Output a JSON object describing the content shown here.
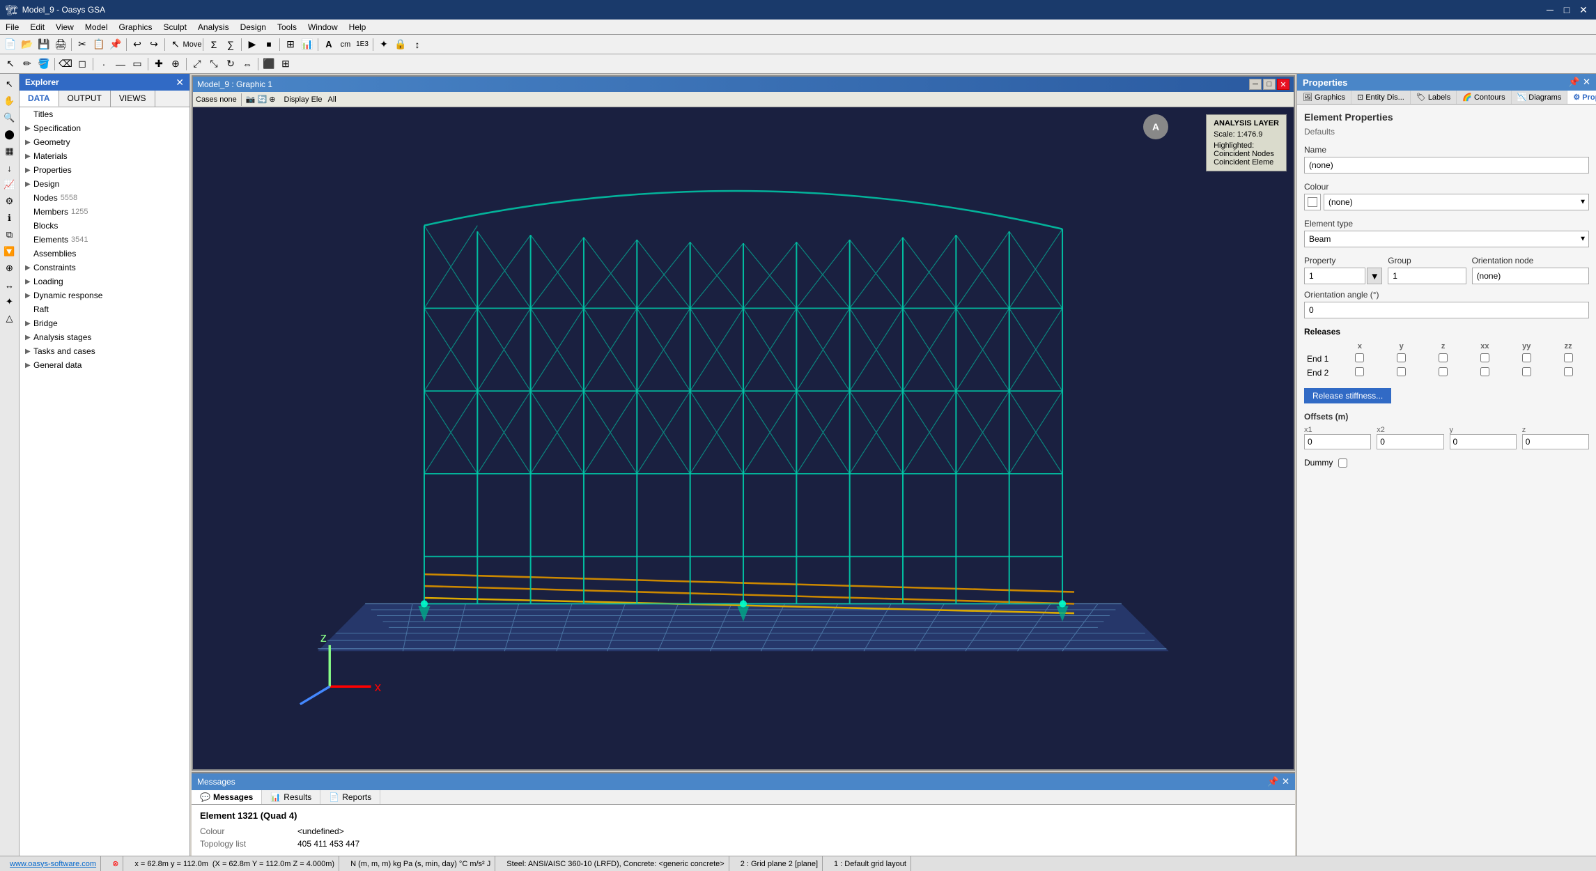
{
  "app": {
    "title": "Model_9 - Oasys GSA",
    "icon": "GSA"
  },
  "titlebar": {
    "minimize": "─",
    "maximize": "□",
    "close": "✕"
  },
  "menubar": {
    "items": [
      "File",
      "Edit",
      "View",
      "Model",
      "Graphics",
      "Sculpt",
      "Analysis",
      "Design",
      "Tools",
      "Window",
      "Help"
    ]
  },
  "explorer": {
    "title": "Explorer",
    "tabs": [
      "DATA",
      "OUTPUT",
      "VIEWS"
    ],
    "active_tab": "DATA",
    "tree": [
      {
        "label": "Titles",
        "type": "leaf",
        "indent": 0
      },
      {
        "label": "Specification",
        "type": "expandable",
        "indent": 0
      },
      {
        "label": "Geometry",
        "type": "expandable",
        "indent": 0
      },
      {
        "label": "Materials",
        "type": "expandable",
        "indent": 0
      },
      {
        "label": "Properties",
        "type": "expandable",
        "indent": 0
      },
      {
        "label": "Design",
        "type": "expandable",
        "indent": 0
      },
      {
        "label": "Nodes",
        "type": "leaf-count",
        "indent": 0,
        "count": "5558"
      },
      {
        "label": "Members",
        "type": "leaf-count",
        "indent": 0,
        "count": "1255"
      },
      {
        "label": "Blocks",
        "type": "leaf",
        "indent": 0
      },
      {
        "label": "Elements",
        "type": "leaf-count",
        "indent": 0,
        "count": "3541"
      },
      {
        "label": "Assemblies",
        "type": "leaf",
        "indent": 0
      },
      {
        "label": "Constraints",
        "type": "expandable",
        "indent": 0
      },
      {
        "label": "Loading",
        "type": "expandable",
        "indent": 0
      },
      {
        "label": "Dynamic response",
        "type": "expandable",
        "indent": 0
      },
      {
        "label": "Raft",
        "type": "leaf",
        "indent": 0
      },
      {
        "label": "Bridge",
        "type": "expandable",
        "indent": 0
      },
      {
        "label": "Analysis stages",
        "type": "expandable",
        "indent": 0
      },
      {
        "label": "Tasks and cases",
        "type": "expandable",
        "indent": 0
      },
      {
        "label": "General data",
        "type": "expandable",
        "indent": 0
      }
    ]
  },
  "graphic_window": {
    "title": "Model_9 : Graphic 1",
    "toolbar_items": [
      "Cases none",
      "Display Ele",
      "All"
    ]
  },
  "analysis_layer": {
    "title": "ANALYSIS LAYER",
    "scale": "Scale: 1:476.9",
    "highlighted": "Highlighted:",
    "coincident_nodes": "Coincident Nodes",
    "coincident_elements": "Coincident Eleme"
  },
  "avatar": {
    "initials": "A"
  },
  "messages": {
    "panel_title": "Messages",
    "tabs": [
      "Messages",
      "Results",
      "Reports"
    ],
    "active_tab": "Messages",
    "element_title": "Element 1321 (Quad 4)",
    "rows": [
      {
        "label": "Colour",
        "value": "<undefined>"
      },
      {
        "label": "Topology list",
        "value": "405 411 453 447"
      }
    ]
  },
  "reports_tab": "Reports",
  "properties": {
    "panel_title": "Properties",
    "tabs": [
      "Graphics",
      "Entity Dis...",
      "Labels",
      "Contours",
      "Diagrams",
      "Properties"
    ],
    "active_tab": "Properties",
    "section_title": "Element Properties",
    "defaults": "Defaults",
    "fields": {
      "name_label": "Name",
      "name_value": "(none)",
      "colour_label": "Colour",
      "colour_value": "(none)",
      "element_type_label": "Element type",
      "element_type_value": "Beam",
      "property_label": "Property",
      "property_value": "1",
      "group_label": "Group",
      "group_value": "1",
      "orientation_node_label": "Orientation node",
      "orientation_node_value": "(none)",
      "orientation_angle_label": "Orientation angle (°)",
      "orientation_angle_value": "0",
      "releases_label": "Releases",
      "releases_cols": [
        "x",
        "y",
        "z",
        "xx",
        "yy",
        "zz"
      ],
      "end1_label": "End 1",
      "end2_label": "End 2",
      "release_stiffness_btn": "Release stiffness...",
      "offsets_label": "Offsets (m)",
      "x1_label": "x1",
      "x1_value": "0",
      "x2_label": "x2",
      "x2_value": "0",
      "y_label": "y",
      "y_value": "0",
      "z_label": "z",
      "z_value": "0",
      "dummy_label": "Dummy"
    }
  },
  "statusbar": {
    "link": "www.oasys-software.com",
    "coords": "x = 62.8m   y = 112.0m",
    "coords2": "(X = 62.8m  Y = 112.0m  Z = 4.000m)",
    "units": "N  (m, m, m)  kg  Pa  (s, min, day)  °C  m/s²  J",
    "error_icon": "⊗",
    "steel": "Steel: ANSI/AISC 360-10 (LRFD), Concrete: <generic concrete>",
    "grid1": "2 : Grid plane 2 [plane]",
    "grid2": "1 : Default grid layout"
  }
}
